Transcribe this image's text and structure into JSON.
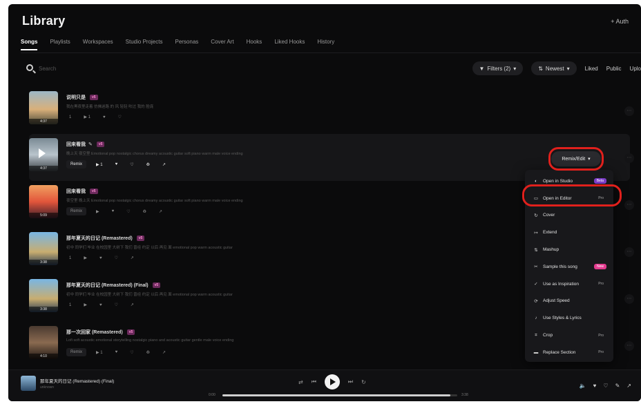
{
  "app": {
    "title": "Library",
    "auth_label": "+ Auth"
  },
  "tabs": [
    "Songs",
    "Playlists",
    "Workspaces",
    "Studio Projects",
    "Personas",
    "Cover Art",
    "Hooks",
    "Liked Hooks",
    "History"
  ],
  "search": {
    "placeholder": "Search"
  },
  "filters": {
    "filter_label": "Filters (2)",
    "sort_label": "Newest",
    "liked": "Liked",
    "public": "Public",
    "uploads": "Uplo"
  },
  "songs": [
    {
      "title": "说明只是",
      "badge": "v5",
      "desc": "我在黑夜里走着 仿佛迷路 的 风 轻轻 吹过 我的 脸庞",
      "duration": "4:37",
      "actions": [
        "1",
        "▶ 1",
        "♥",
        "♡"
      ],
      "theme": "a"
    },
    {
      "title": "回来看我",
      "badge": "v5",
      "desc": "晚上天 夜空里 Emotional pop nostalgic chorus dreamy acoustic guitar soft piano warm male voice ending",
      "duration": "4:37",
      "actions": [
        "Remix",
        "▶ 1",
        "♥",
        "♡",
        "♻",
        "↗"
      ],
      "theme": "b"
    },
    {
      "title": "回来看我",
      "badge": "v5",
      "desc": "夜空里 晚上天 Emotional pop nostalgic chorus dreamy acoustic guitar soft piano warm male voice ending",
      "duration": "5:09",
      "actions": [
        "Remix",
        "▶",
        "♥",
        "♡",
        "♻",
        "↗"
      ],
      "theme": "c"
    },
    {
      "title": "那年夏天的日记 (Remastered)",
      "badge": "v5",
      "desc": "初中 同学们 毕业 在校园里 大树下 我们 曾经 约定 以后 再见 面 emotional pop warm acoustic guitar",
      "duration": "3:38",
      "actions": [
        "1",
        "▶",
        "♥",
        "♡",
        "↗"
      ],
      "theme": "d"
    },
    {
      "title": "那年夏天的日记 (Remastered) (Final)",
      "badge": "v5",
      "desc": "初中 同学们 毕业 在校园里 大树下 我们 曾经 约定 以后 再见 面 emotional pop warm acoustic guitar",
      "duration": "3:38",
      "actions": [
        "1",
        "▶",
        "♥",
        "♡",
        "↗"
      ],
      "theme": "d"
    },
    {
      "title": "那一次回家 (Remastered)",
      "badge": "v5",
      "desc": "Lofi soft acoustic emotional storytelling nostalgic piano and acoustic guitar gentle male voice ending",
      "duration": "4:10",
      "actions": [
        "Remix",
        "▶ 1",
        "♥",
        "♡",
        "♻",
        "↗"
      ],
      "theme": "e"
    }
  ],
  "remix": {
    "label": "Remix/Edit"
  },
  "menu": [
    {
      "icon": "studio",
      "label": "Open in Studio",
      "tag": "Beta",
      "tag_type": "beta"
    },
    {
      "icon": "editor",
      "label": "Open in Editor",
      "tag": "Pro",
      "tag_type": "pro"
    },
    {
      "icon": "cover",
      "label": "Cover",
      "tag": "",
      "tag_type": ""
    },
    {
      "icon": "extend",
      "label": "Extend",
      "tag": "",
      "tag_type": ""
    },
    {
      "icon": "mashup",
      "label": "Mashup",
      "tag": "",
      "tag_type": ""
    },
    {
      "icon": "sample",
      "label": "Sample this song",
      "tag": "New",
      "tag_type": "new"
    },
    {
      "icon": "inspiration",
      "label": "Use as Inspiration",
      "tag": "Pro",
      "tag_type": "pro"
    },
    {
      "icon": "speed",
      "label": "Adjust Speed",
      "tag": "",
      "tag_type": ""
    },
    {
      "icon": "styles",
      "label": "Use Styles & Lyrics",
      "tag": "",
      "tag_type": ""
    },
    {
      "icon": "crop",
      "label": "Crop",
      "tag": "Pro",
      "tag_type": "pro"
    },
    {
      "icon": "replace",
      "label": "Replace Section",
      "tag": "Pro",
      "tag_type": "pro"
    }
  ],
  "player": {
    "title": "那年夏天的日记 (Remastered) (Final)",
    "artist": "unknown",
    "time_start": "0:00",
    "time_end": "3:38",
    "progress": 0.97
  },
  "colors": {
    "accent_ring": "#e0201c",
    "new_tag": "#e23a8e",
    "beta_tag": "#7b3cc7"
  }
}
